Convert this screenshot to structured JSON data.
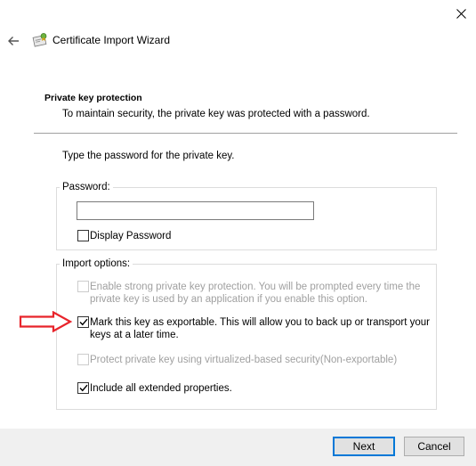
{
  "window": {
    "title": "Certificate Import Wizard"
  },
  "header": {
    "heading": "Private key protection",
    "description": "To maintain security, the private key was protected with a password."
  },
  "main": {
    "instruction": "Type the password for the private key.",
    "password_group": {
      "label": "Password:",
      "value": "",
      "display_password": {
        "label": "Display Password",
        "checked": false
      }
    },
    "import_options": {
      "label": "Import options:",
      "options": [
        {
          "line1": "Enable strong private key protection. You will be prompted every time the",
          "line2": "private key is used by an application if you enable this option.",
          "checked": false,
          "enabled": false
        },
        {
          "line1": "Mark this key as exportable. This will allow you to back up or transport your",
          "line2": "keys at a later time.",
          "checked": true,
          "enabled": true
        },
        {
          "line1": "Protect private key using virtualized-based security(Non-exportable)",
          "checked": false,
          "enabled": false
        },
        {
          "line1": "Include all extended properties.",
          "checked": true,
          "enabled": true
        }
      ]
    }
  },
  "footer": {
    "next_label": "Next",
    "cancel_label": "Cancel"
  },
  "icons": {
    "close": "close-icon",
    "back": "back-arrow-icon",
    "wizard": "certificate-icon",
    "annotation": "red-arrow-annotation",
    "check": "checkmark-icon"
  },
  "colors": {
    "accent": "#0078d7",
    "annotation": "#e8242b",
    "footer_bg": "#f0f0f0"
  }
}
